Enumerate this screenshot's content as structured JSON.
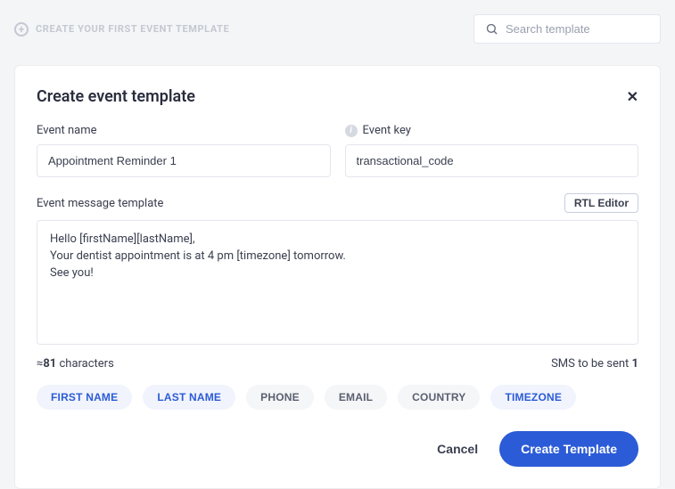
{
  "header": {
    "breadcrumb": "CREATE YOUR FIRST EVENT TEMPLATE",
    "search_placeholder": "Search template"
  },
  "card": {
    "title": "Create event template",
    "close": "✕",
    "event_name_label": "Event name",
    "event_name_value": "Appointment Reminder 1",
    "event_key_label": "Event key",
    "event_key_value": "transactional_code",
    "message_label": "Event message template",
    "rtl_button": "RTL Editor",
    "message_value": "Hello [firstName][lastName],\nYour dentist appointment is at 4 pm [timezone] tomorrow.\nSee you!",
    "count_prefix": "≈",
    "count_value": "81",
    "count_suffix": " characters",
    "sms_prefix": "SMS to be sent ",
    "sms_value": "1",
    "chips": [
      {
        "label": "FIRST NAME",
        "active": true
      },
      {
        "label": "LAST NAME",
        "active": true
      },
      {
        "label": "PHONE",
        "active": false
      },
      {
        "label": "EMAIL",
        "active": false
      },
      {
        "label": "COUNTRY",
        "active": false
      },
      {
        "label": "TIMEZONE",
        "active": true
      }
    ],
    "cancel": "Cancel",
    "create": "Create Template"
  }
}
